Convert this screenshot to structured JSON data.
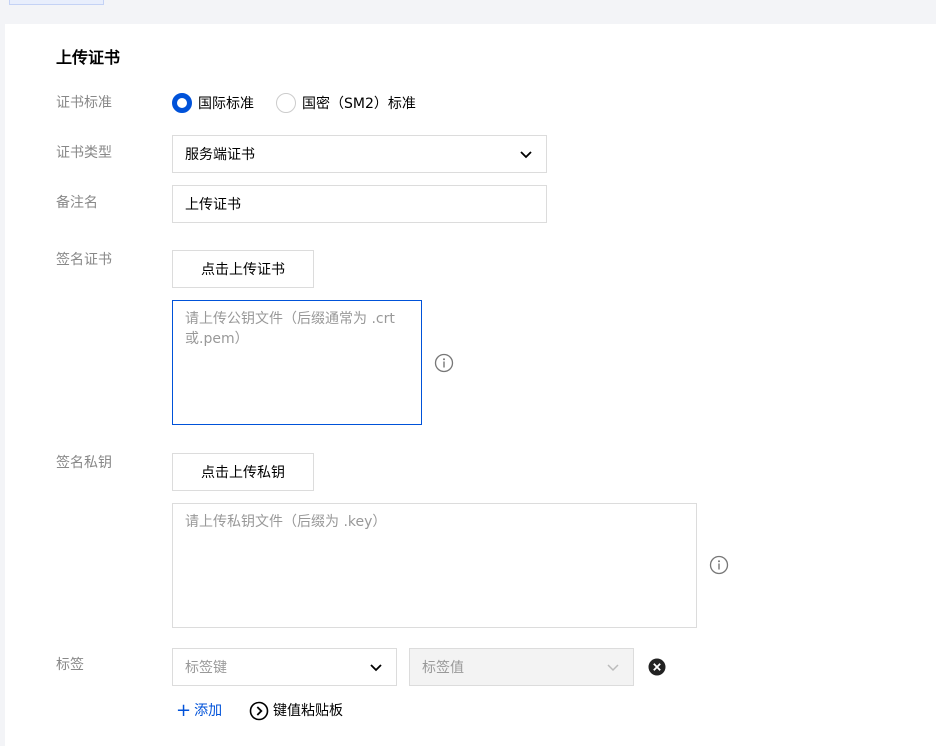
{
  "title": "上传证书",
  "standard": {
    "label": "证书标准",
    "options": [
      "国际标准",
      "国密（SM2）标准"
    ],
    "selected": "国际标准"
  },
  "cert_type": {
    "label": "证书类型",
    "value": "服务端证书"
  },
  "remark": {
    "label": "备注名",
    "value": "上传证书"
  },
  "sign_cert": {
    "label": "签名证书",
    "button": "点击上传证书",
    "placeholder": "请上传公钥文件（后缀通常为 .crt 或.pem）"
  },
  "sign_key": {
    "label": "签名私钥",
    "button": "点击上传私钥",
    "placeholder": "请上传私钥文件（后缀为 .key）"
  },
  "tags": {
    "label": "标签",
    "key_placeholder": "标签键",
    "value_placeholder": "标签值",
    "add": "添加",
    "paste": "键值粘贴板"
  },
  "colors": {
    "accent": "#0052d9",
    "label": "#888888",
    "border": "#dcdcdc"
  },
  "icons": {
    "chevron": "chevron-down-icon",
    "info": "info-icon",
    "remove": "close-circle-icon",
    "add": "plus-icon",
    "paste": "chevron-right-circle-icon"
  }
}
